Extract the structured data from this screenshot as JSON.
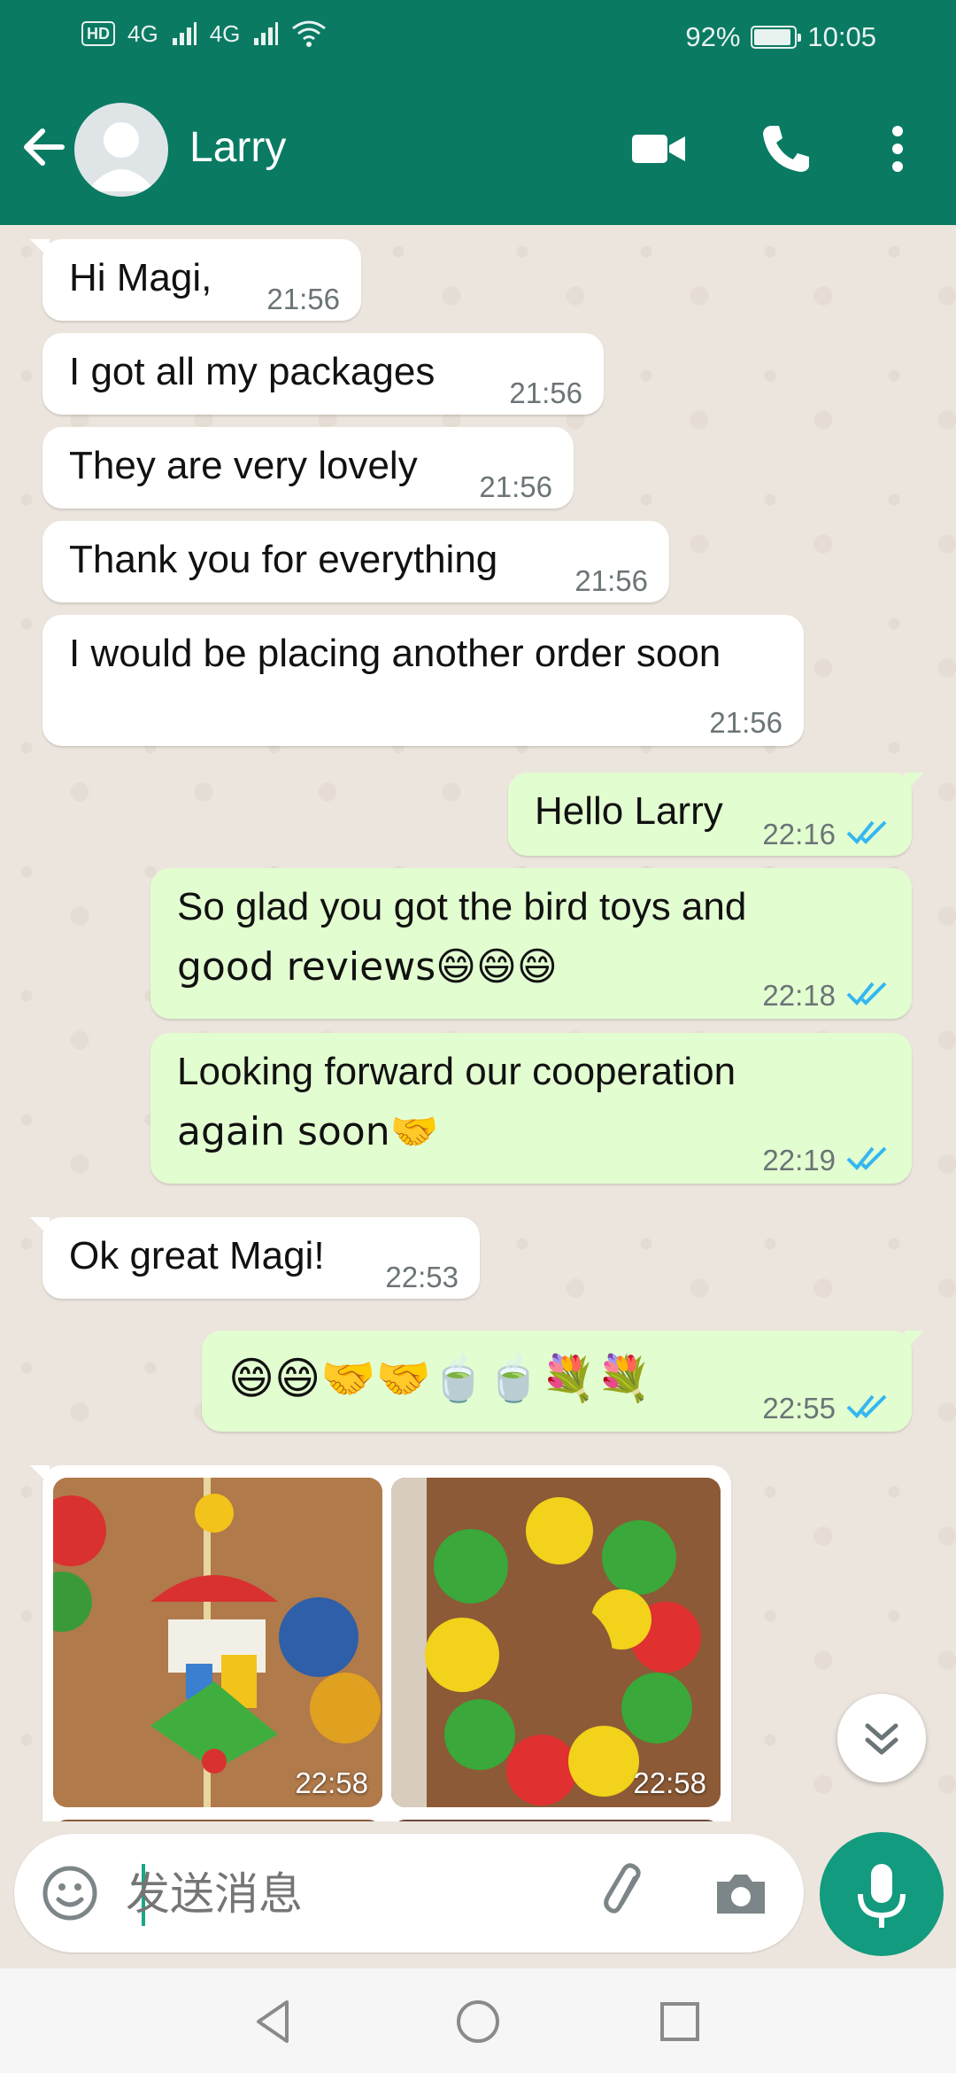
{
  "status_bar": {
    "hd_badge": "HD",
    "signal1": "4G",
    "signal2": "4G",
    "battery": "92%",
    "battery_level": 0.92,
    "time": "10:05"
  },
  "header": {
    "contact_name": "Larry",
    "icons": [
      "back-arrow-icon",
      "avatar",
      "video-call-icon",
      "phone-icon",
      "more-vert-icon"
    ]
  },
  "messages": [
    {
      "dir": "in",
      "text": "Hi Magi,",
      "time": "21:56"
    },
    {
      "dir": "in",
      "text": "I got all my packages",
      "time": "21:56"
    },
    {
      "dir": "in",
      "text": "They are very lovely",
      "time": "21:56"
    },
    {
      "dir": "in",
      "text": "Thank you for everything",
      "time": "21:56"
    },
    {
      "dir": "in",
      "text": "I would be placing another order soon",
      "time": "21:56"
    },
    {
      "dir": "out",
      "text": "Hello Larry",
      "time": "22:16"
    },
    {
      "dir": "out",
      "line1": "So glad you got the bird toys and",
      "line2": "good reviews😄😄😄",
      "time": "22:18"
    },
    {
      "dir": "out",
      "line1": "Looking forward our cooperation",
      "line2": "again soon🤝",
      "time": "22:19"
    },
    {
      "dir": "in",
      "text": "Ok great Magi!",
      "time": "22:53"
    },
    {
      "dir": "out",
      "text": "😄😄🤝🤝🍵🍵💐💐",
      "time": "22:55"
    }
  ],
  "images": [
    {
      "time": "22:58"
    },
    {
      "time": "22:58"
    }
  ],
  "composer": {
    "placeholder": "发送消息"
  },
  "colors": {
    "header": "#0a7a63",
    "incoming": "#ffffff",
    "outgoing": "#e2fdd0",
    "read_ticks": "#34b7f1",
    "mic_button": "#129b7e"
  }
}
